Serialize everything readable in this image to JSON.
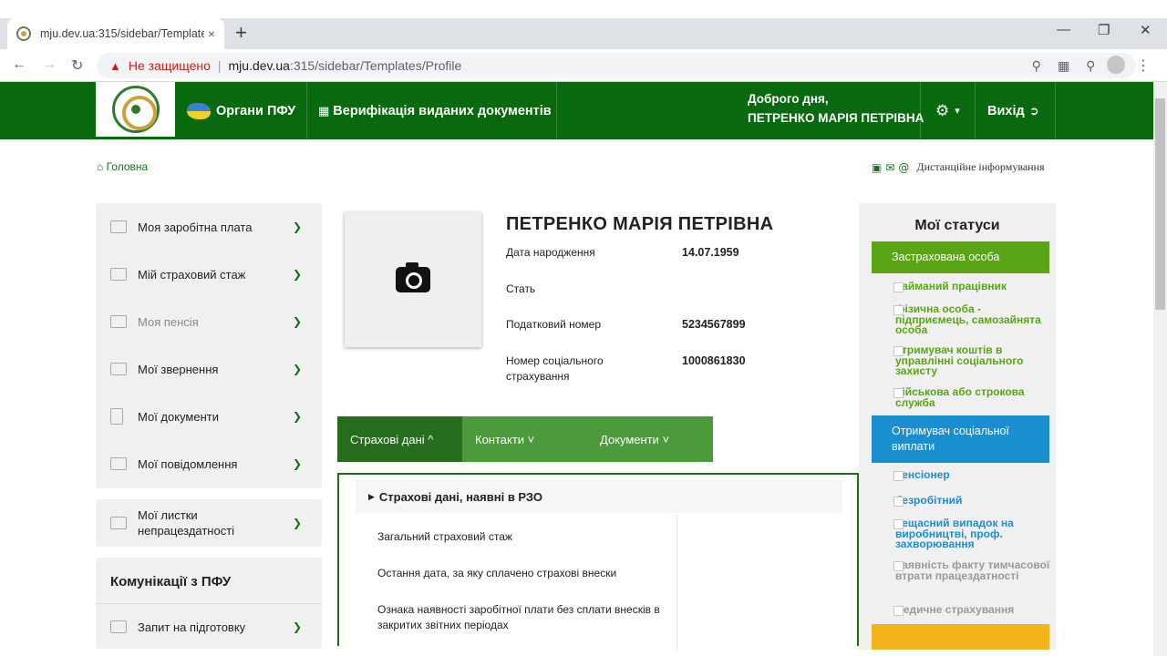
{
  "browser": {
    "tab_title": "mju.dev.ua:315/sidebar/Template",
    "tab_close": "×",
    "new_tab": "+",
    "not_secure": "Не защищено",
    "url_host": "mju.dev.ua",
    "url_rest": ":315/sidebar/Templates/Profile"
  },
  "header": {
    "pfu_bodies": "Органи ПФУ",
    "verification": "Верифікація виданих документів",
    "greeting_line1": "Доброго дня,",
    "greeting_line2": "ПЕТРЕНКО МАРІЯ ПЕТРІВНА",
    "settings_caret": "▾",
    "logout": "Вихід"
  },
  "breadcrumb": {
    "home": "Головна"
  },
  "remote_info": "Дистанційне інформування",
  "sidebar": {
    "items": [
      {
        "label": "Моя заробітна плата"
      },
      {
        "label": "Мій страховий стаж"
      },
      {
        "label": "Моя пенсія"
      },
      {
        "label": "Мої звернення"
      },
      {
        "label": "Мої документи"
      },
      {
        "label": "Мої повідомлення"
      }
    ],
    "sick_leave_line1": "Мої листки",
    "sick_leave_line2": "непрацездатності",
    "communications_title": "Комунікації з ПФУ",
    "request_label": "Запит на підготовку"
  },
  "profile": {
    "name": "ПЕТРЕНКО МАРІЯ ПЕТРІВНА",
    "birth_label": "Дата народження",
    "birth_value": "14.07.1959",
    "sex_label": "Стать",
    "tax_label": "Податковий номер",
    "tax_value": "5234567899",
    "social_label_line1": "Номер соціального",
    "social_label_line2": "страхування",
    "social_value": "1000861830"
  },
  "tabs": {
    "insurance": "Страхові дані ^",
    "contacts": "Контакти ˅",
    "documents": "Документи ˅"
  },
  "insurance_panel": {
    "header": "Страхові дані, наявні в РЗО",
    "rows": [
      "Загальний страховий стаж",
      "Остання дата, за яку сплачено страхові внески",
      "Ознака наявності заробітної плати без сплати внесків в закритих звітних періодах"
    ]
  },
  "statuses": {
    "title": "Мої статуси",
    "insured_header": "Застрахована особа",
    "insured_options": [
      "найманий працівник",
      "фізична особа - підприємець, самозайнята особа",
      "отримувач коштів в управлінні соціального захисту",
      "військова або строкова служба"
    ],
    "social_header": "Отримувач соціальної виплати",
    "social_options": [
      "пенсіонер",
      "безробітний",
      "нещасний випадок на виробництві, проф. захворювання",
      "наявність факту тимчасової втрати працездатності",
      "медичне страхування"
    ],
    "colors": {
      "insured_bg": "#5aa516",
      "insured_text": "#5aa516",
      "social_bg": "#1a8fd0",
      "social_text": "#1a8fd0",
      "muted_text": "#9a9a9a",
      "next_bg": "#f3b51b"
    }
  }
}
